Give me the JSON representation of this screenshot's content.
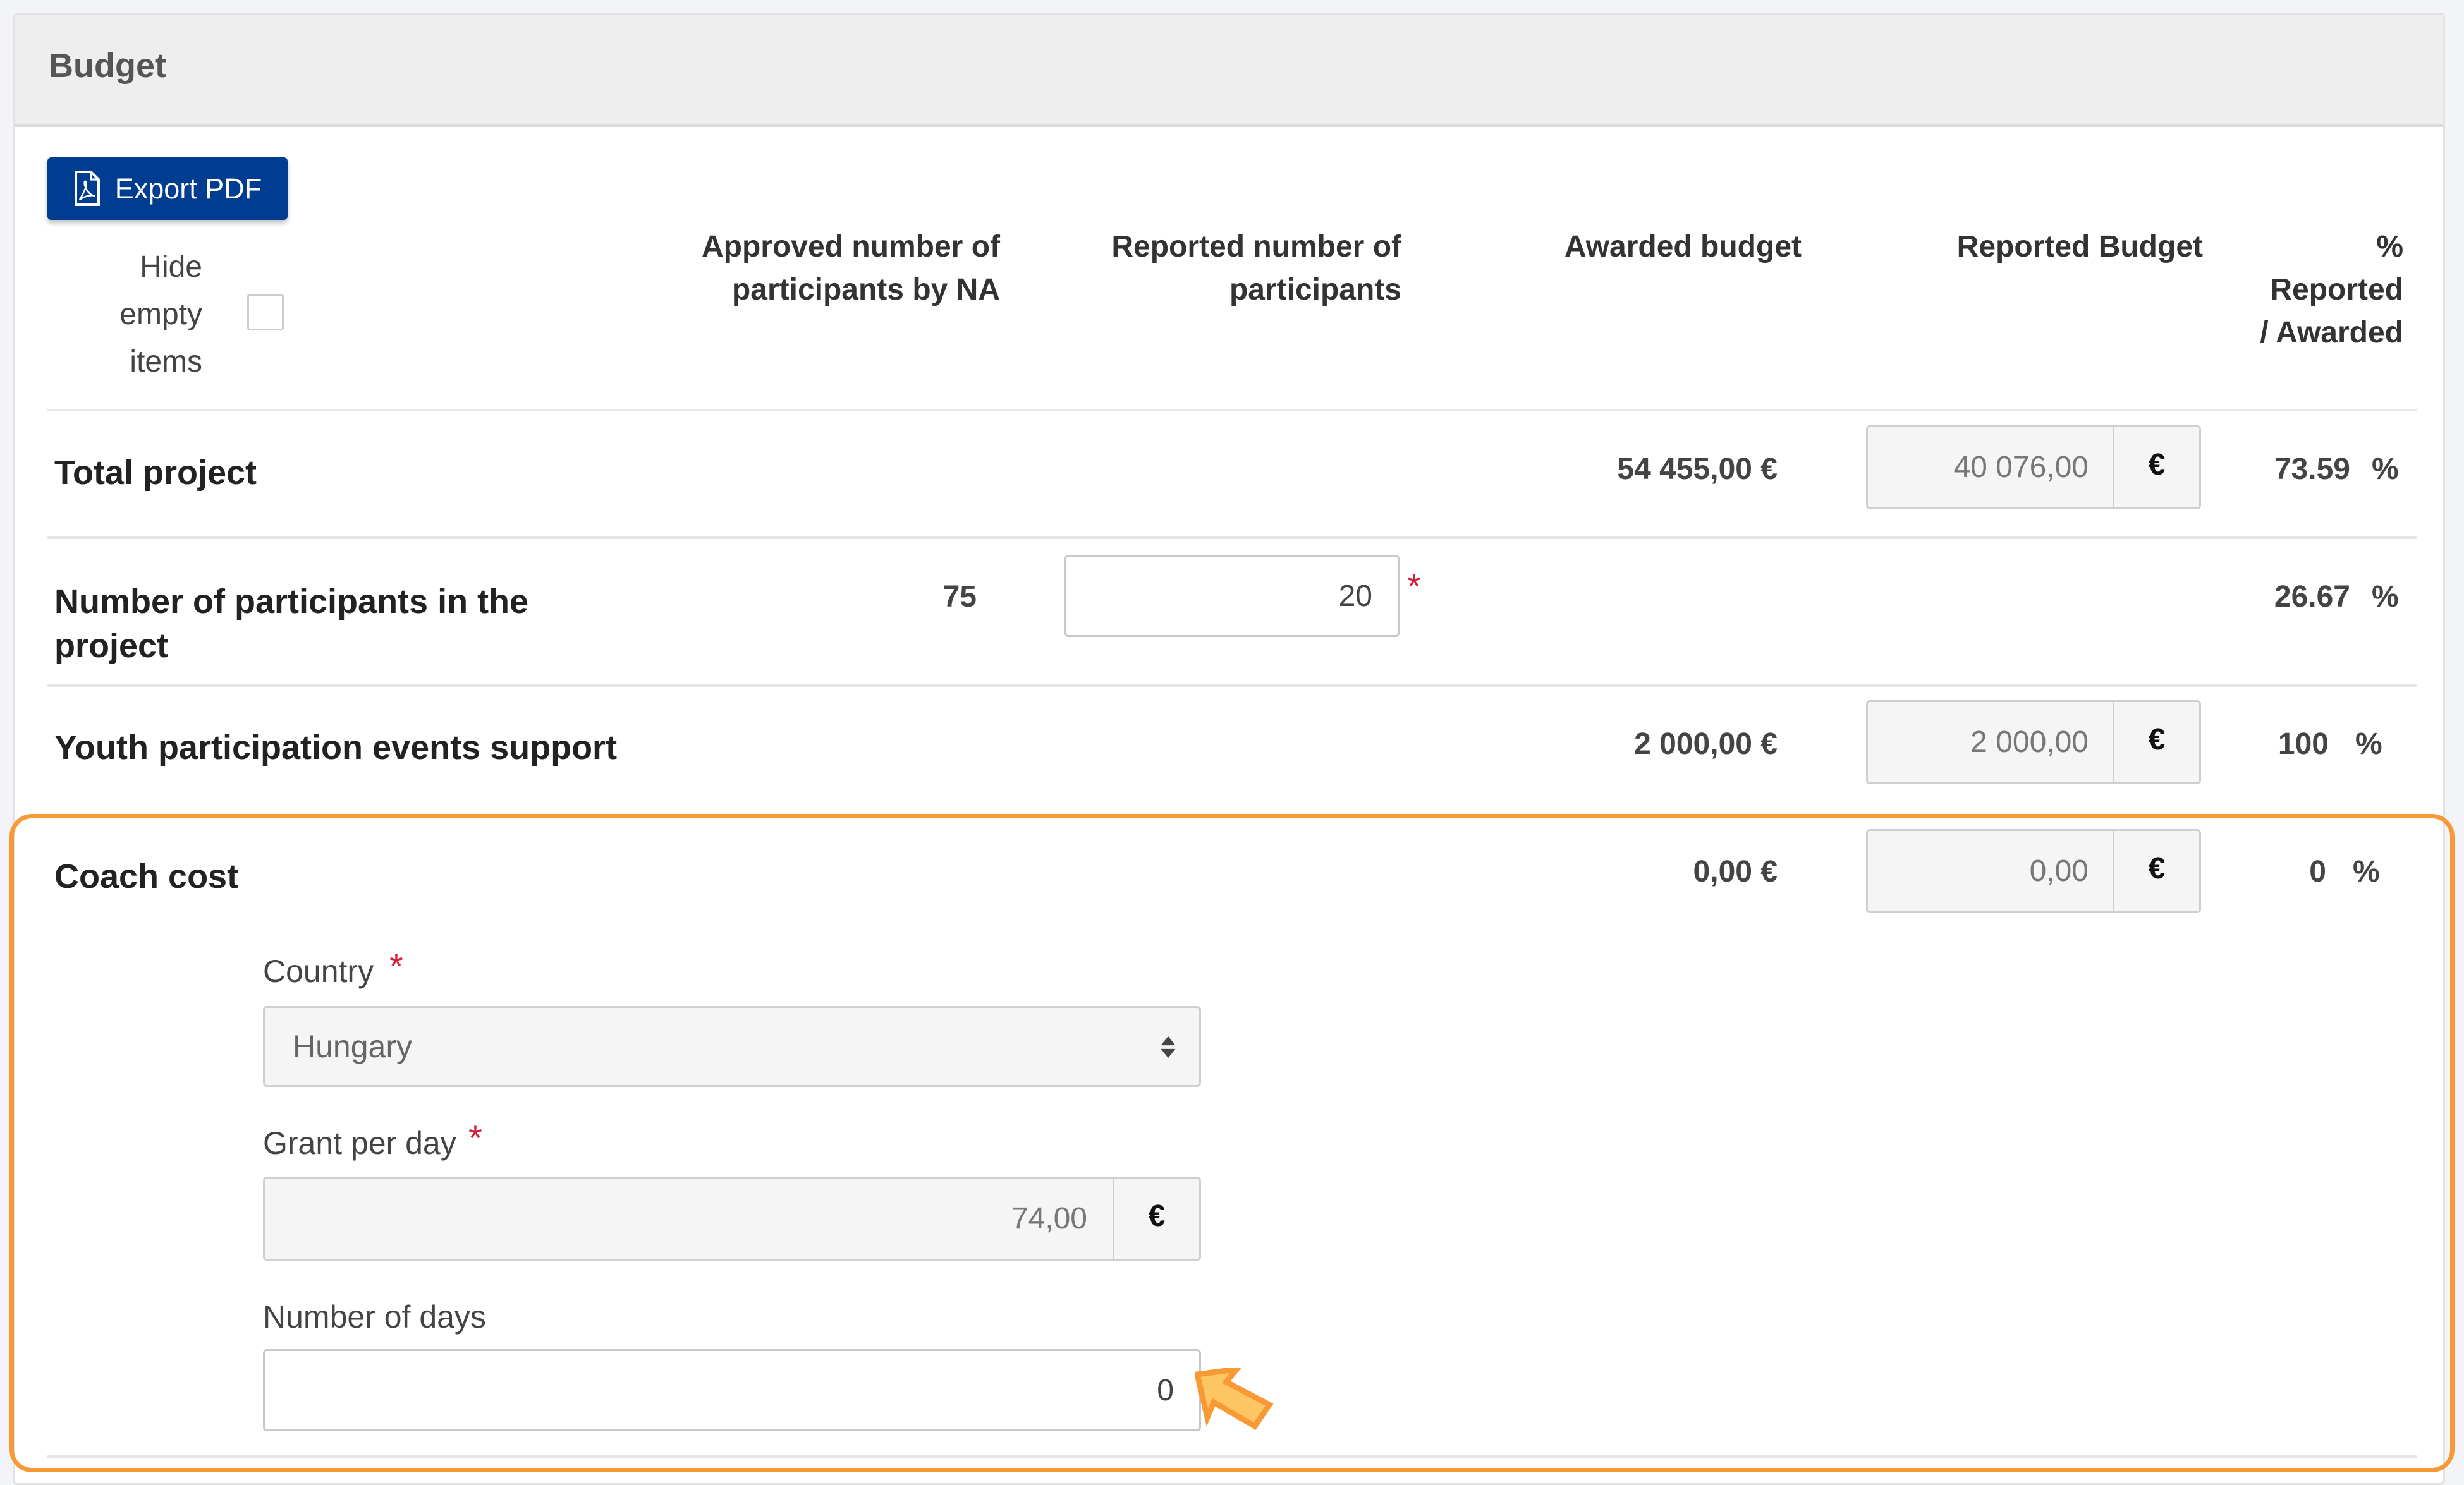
{
  "panel": {
    "title": "Budget"
  },
  "toolbar": {
    "export_label": "Export PDF",
    "hide_empty_label_lines": [
      "Hide",
      "empty",
      "items"
    ],
    "hide_empty_checked": false
  },
  "columns": {
    "approved": [
      "Approved number of",
      "participants by NA"
    ],
    "reported_participants": [
      "Reported number of",
      "participants"
    ],
    "awarded": "Awarded budget",
    "reported_budget": "Reported Budget",
    "percent": [
      "%",
      "Reported",
      "/ Awarded"
    ]
  },
  "rows": {
    "total": {
      "label": "Total project",
      "awarded": "54 455,00 €",
      "reported": "40 076,00",
      "currency": "€",
      "percent": "73.59",
      "percent_sign": "%"
    },
    "participants": {
      "label_lines": [
        "Number of participants in the",
        "project"
      ],
      "approved": "75",
      "reported": "20",
      "required_mark": "*",
      "percent": "26.67",
      "percent_sign": "%"
    },
    "youth": {
      "label": "Youth participation events support",
      "awarded": "2 000,00 €",
      "reported": "2 000,00",
      "currency": "€",
      "percent": "100",
      "percent_sign": "%"
    },
    "coach": {
      "label": "Coach cost",
      "awarded": "0,00 €",
      "reported": "0,00",
      "currency": "€",
      "percent": "0",
      "percent_sign": "%",
      "fields": {
        "country": {
          "label": "Country",
          "required_mark": "*",
          "value": "Hungary"
        },
        "grant_per_day": {
          "label": "Grant per day",
          "required_mark": "*",
          "value": "74,00",
          "currency": "€"
        },
        "days": {
          "label": "Number of days",
          "value": "0"
        }
      }
    }
  },
  "highlight": {
    "color": "#f79a36",
    "arrow_fill": "#fdc663",
    "target": "Number of days"
  },
  "colors": {
    "primary": "#003c8f",
    "required": "#d0243b"
  }
}
